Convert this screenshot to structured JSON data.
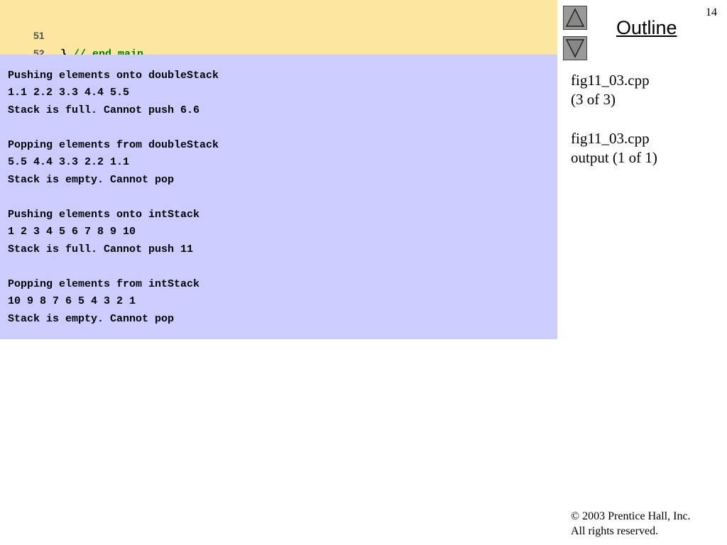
{
  "code": {
    "lines": [
      {
        "number": "51",
        "brace": "",
        "comment": ""
      },
      {
        "number": "52",
        "brace": "}",
        "comment": "// end main"
      }
    ]
  },
  "output": {
    "lines": [
      "Pushing elements onto doubleStack",
      "1.1 2.2 3.3 4.4 5.5",
      "Stack is full. Cannot push 6.6",
      "",
      "Popping elements from doubleStack",
      "5.5 4.4 3.3 2.2 1.1",
      "Stack is empty. Cannot pop",
      "",
      "Pushing elements onto intStack",
      "1 2 3 4 5 6 7 8 9 10",
      "Stack is full. Cannot push 11",
      "",
      "Popping elements from intStack",
      "10 9 8 7 6 5 4 3 2 1",
      "Stack is empty. Cannot pop"
    ]
  },
  "sidebar": {
    "page_number": "14",
    "outline_title": "Outline",
    "nav_up_icon": "triangle-up-icon",
    "nav_down_icon": "triangle-down-icon",
    "file1_name": "fig11_03.cpp",
    "file1_part": "(3 of 3)",
    "file2_name": "fig11_03.cpp",
    "file2_part": "output (1 of 1)",
    "copyright_line1": "© 2003 Prentice Hall, Inc.",
    "copyright_line2": "All rights reserved."
  },
  "colors": {
    "code_bg": "#fde69f",
    "output_bg": "#ccccff",
    "comment": "#008000",
    "nav_button": "#999999"
  }
}
